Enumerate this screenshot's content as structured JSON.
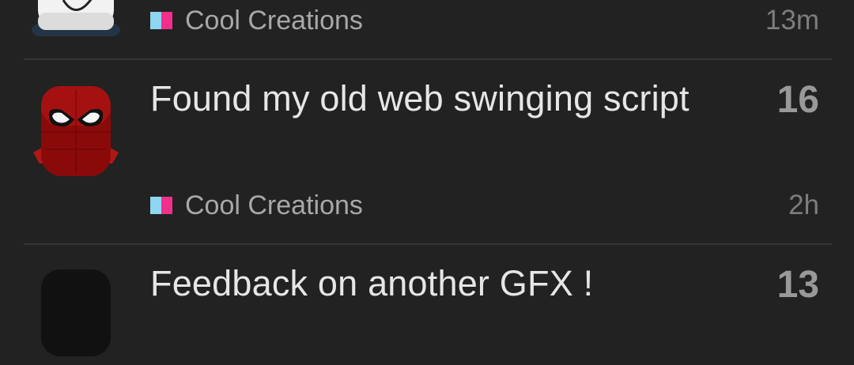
{
  "colors": {
    "background": "#222222",
    "divider": "#363636",
    "title_text": "#e6e6e6",
    "reply_count": "#999999",
    "category_text": "#a8a8a8",
    "age_text": "#7d7d7d",
    "category_badge_left": "#8ed6f2",
    "category_badge_right": "#f0308a"
  },
  "topics": [
    {
      "title": "",
      "category": "Cool Creations",
      "age": "13m",
      "replies": "",
      "avatar_icon": "white-robloxian-head-avatar"
    },
    {
      "title": "Found my old web swinging script",
      "category": "Cool Creations",
      "age": "2h",
      "replies": "16",
      "avatar_icon": "red-spider-mask-avatar"
    },
    {
      "title": "Feedback on another GFX !",
      "category": "",
      "age": "",
      "replies": "13",
      "avatar_icon": "black-masked-avatar"
    }
  ]
}
